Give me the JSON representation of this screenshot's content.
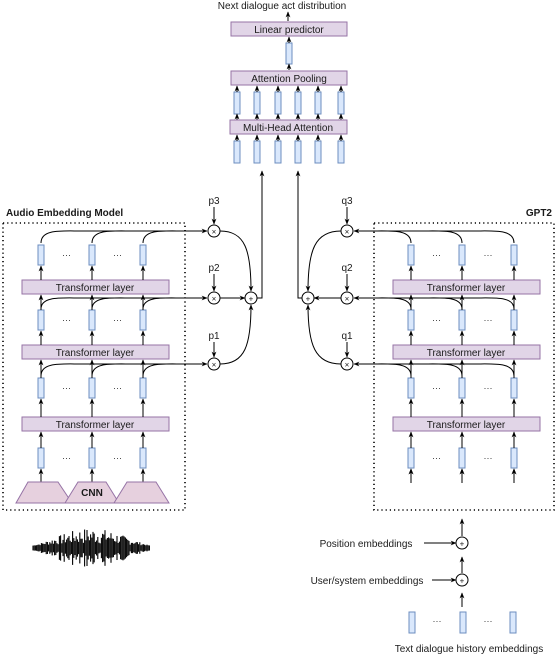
{
  "diagram": {
    "top": {
      "output_label": "Next dialogue act distribution",
      "linear_predictor": "Linear predictor",
      "attention_pooling": "Attention Pooling",
      "multi_head_attention": "Multi-Head Attention"
    },
    "audio_model": {
      "title": "Audio Embedding Model",
      "layers": [
        "Transformer layer",
        "Transformer layer",
        "Transformer layer"
      ],
      "cnn_label": "CNN",
      "weights": [
        "p3",
        "p2",
        "p1"
      ],
      "ellipsis": "···"
    },
    "text_model": {
      "title": "GPT2",
      "layers": [
        "Transformer layer",
        "Transformer layer",
        "Transformer layer"
      ],
      "weights": [
        "q3",
        "q2",
        "q1"
      ],
      "ellipsis": "···"
    },
    "inputs": {
      "position_embeddings": "Position embeddings",
      "user_system_embeddings": "User/system embeddings",
      "text_history": "Text dialogue history embeddings"
    },
    "operators": {
      "multiply": "×",
      "add": "+"
    },
    "colors": {
      "layer_fill": "#e1d5e7",
      "layer_stroke": "#9673a6",
      "vector_fill": "#dae8fc",
      "vector_stroke": "#6c8ebf"
    }
  }
}
